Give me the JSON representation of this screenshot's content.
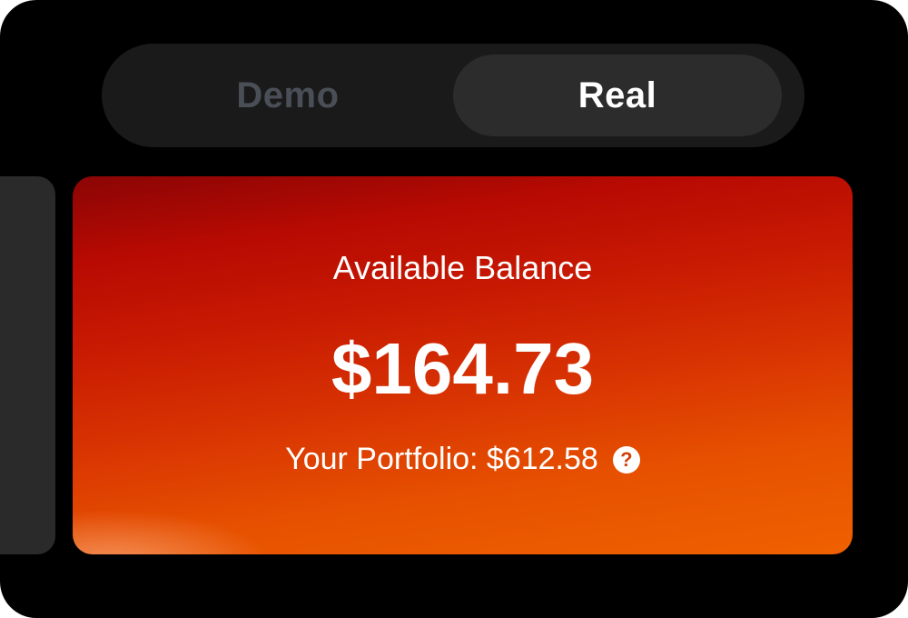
{
  "mode_switch": {
    "demo_label": "Demo",
    "real_label": "Real",
    "selected": "Real"
  },
  "balance_card": {
    "title": "Available Balance",
    "amount": "$164.73",
    "portfolio_label": "Your Portfolio: $612.58",
    "help_icon": "question-circle-icon"
  },
  "colors": {
    "background": "#000000",
    "switch_track": "#1a1a1a",
    "switch_selected": "#2c2c2c",
    "inactive_text": "#4a4f57",
    "card_gradient_start": "#8a0505",
    "card_gradient_end": "#ef6100"
  }
}
